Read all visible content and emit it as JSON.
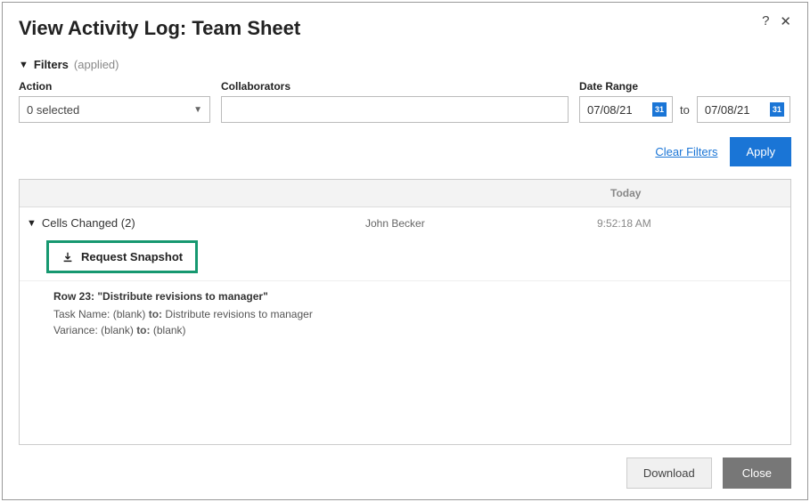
{
  "dialog": {
    "title": "View Activity Log: Team Sheet"
  },
  "filters": {
    "label": "Filters",
    "applied": "(applied)",
    "action": {
      "label": "Action",
      "value": "0 selected"
    },
    "collaborators": {
      "label": "Collaborators",
      "value": ""
    },
    "dateRange": {
      "label": "Date Range",
      "from": "07/08/21",
      "to_label": "to",
      "to": "07/08/21"
    },
    "clear": "Clear Filters",
    "apply": "Apply"
  },
  "log": {
    "dateHeader": "Today",
    "entries": [
      {
        "event": "Cells Changed (2)",
        "user": "John Becker",
        "time": "9:52:18 AM",
        "snapshot_label": "Request Snapshot",
        "rowTitle": "Row 23: \"Distribute revisions to manager\"",
        "changes": [
          {
            "field": "Task Name:",
            "from": "(blank)",
            "toLabel": "to:",
            "to": "Distribute revisions to manager"
          },
          {
            "field": "Variance:",
            "from": "(blank)",
            "toLabel": "to:",
            "to": "(blank)"
          }
        ]
      }
    ]
  },
  "footer": {
    "download": "Download",
    "close": "Close"
  }
}
